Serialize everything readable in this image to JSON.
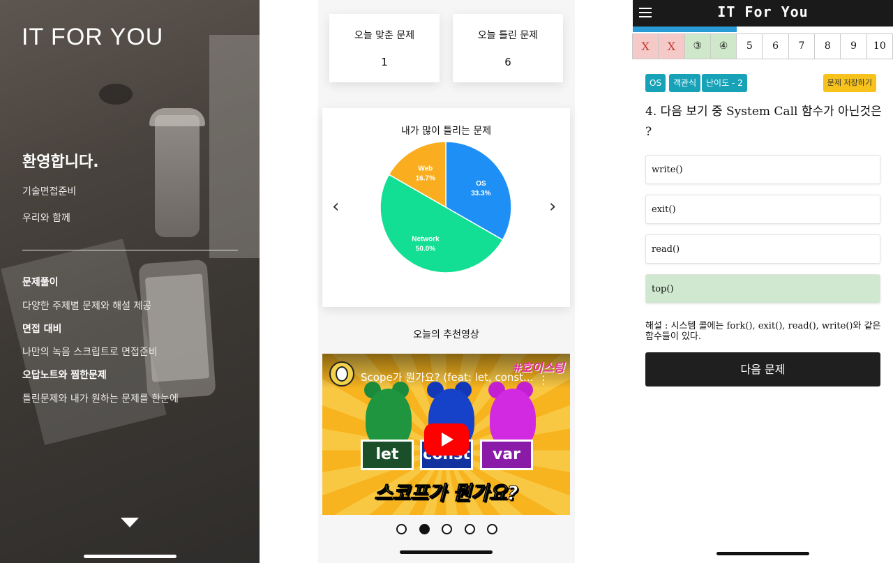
{
  "landing": {
    "brand": "IT FOR YOU",
    "welcome": "환영합니다.",
    "subtitle_1": "기술면접준비",
    "subtitle_2": "우리와 함께",
    "features": [
      {
        "title": "문제풀이",
        "desc": "다양한 주제별 문제와 해설 제공"
      },
      {
        "title": "면접 대비",
        "desc": "나만의 녹음 스크립트로 면접준비"
      },
      {
        "title": "오답노트와 찜한문제",
        "desc": "틀린문제와 내가 원하는 문제를 한눈에"
      }
    ]
  },
  "dashboard": {
    "correct_label": "오늘 맞춘 문제",
    "correct_value": "1",
    "wrong_label": "오늘 틀린 문제",
    "wrong_value": "6",
    "chart_title": "내가 많이 틀리는 문제",
    "recommend_title": "오늘의 추천영상",
    "video": {
      "title": "Scope가 뭔가요? (feat: let, const...",
      "tag": "#호이스팅",
      "signs": [
        "let",
        "const",
        "var"
      ],
      "caption_highlight": "스코프",
      "caption_rest": "가 뭔가요?"
    },
    "carousel": {
      "count": 5,
      "active_index": 1
    },
    "colors": {
      "os": "#1e90f5",
      "network": "#12df93",
      "web": "#f9ad1f"
    }
  },
  "chart_data": {
    "type": "pie",
    "title": "내가 많이 틀리는 문제",
    "categories": [
      "OS",
      "Network",
      "Web"
    ],
    "values": [
      33.3,
      50.0,
      16.7
    ],
    "labels": [
      "33.3%",
      "50.0%",
      "16.7%"
    ]
  },
  "quiz": {
    "app_title": "IT For You",
    "progress_fraction": 0.4,
    "question_numbers": [
      {
        "label": "X",
        "state": "wrong"
      },
      {
        "label": "X",
        "state": "wrong"
      },
      {
        "label": "③",
        "state": "right"
      },
      {
        "label": "④",
        "state": "right"
      },
      {
        "label": "5",
        "state": "none"
      },
      {
        "label": "6",
        "state": "none"
      },
      {
        "label": "7",
        "state": "none"
      },
      {
        "label": "8",
        "state": "none"
      },
      {
        "label": "9",
        "state": "none"
      },
      {
        "label": "10",
        "state": "none"
      }
    ],
    "badges": [
      "OS",
      "객관식",
      "난이도 - 2"
    ],
    "save_label": "문제 저장하기",
    "question": "4. 다음 보기 중 System Call 함수가 아닌것은 ?",
    "options": [
      "write()",
      "exit()",
      "read()",
      "top()"
    ],
    "correct_option_index": 3,
    "explanation": "해설 : 시스템 콜에는 fork(), exit(), read(), write()와 같은 함수들이 있다.",
    "next_label": "다음 문제"
  }
}
